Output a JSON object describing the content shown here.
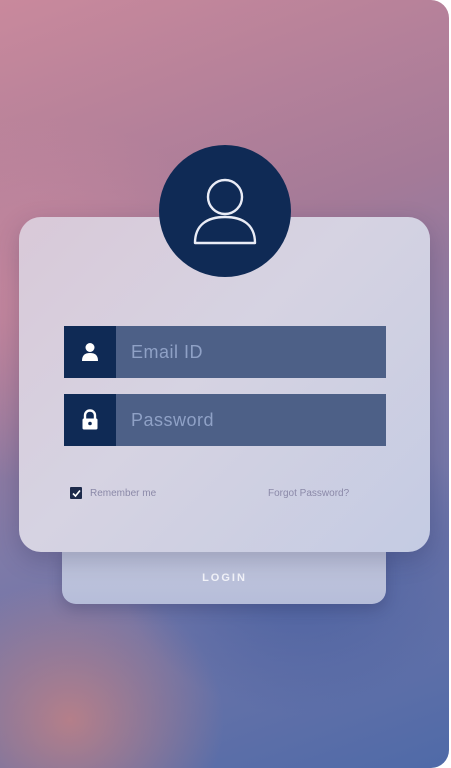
{
  "form": {
    "email_placeholder": "Email ID",
    "password_placeholder": "Password",
    "remember_label": "Remember me",
    "remember_checked": true,
    "forgot_label": "Forgot Password?",
    "login_label": "LOGIN"
  },
  "icons": {
    "avatar": "user-icon",
    "email": "user-icon",
    "password": "lock-icon",
    "checkbox": "check-icon"
  },
  "colors": {
    "navy": "#0f2a55",
    "field_bg": "#4d6087",
    "field_text": "#8fa1c6"
  }
}
